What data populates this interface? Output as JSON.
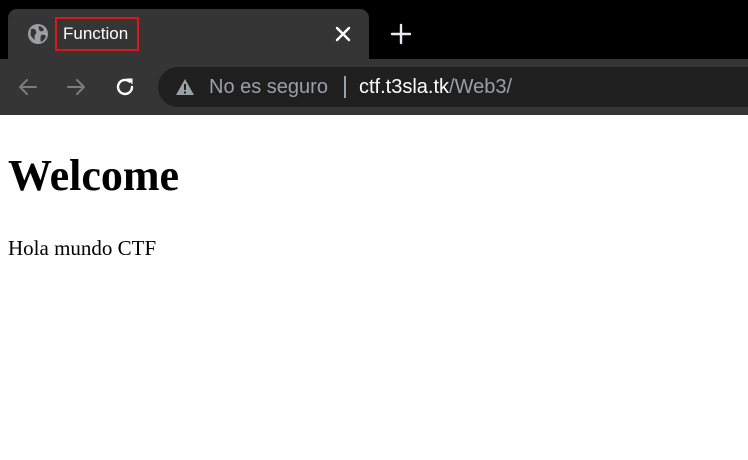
{
  "browser": {
    "tab": {
      "title": "Function",
      "favicon_icon": "globe-icon",
      "close_icon": "close-icon",
      "highlight_color": "#e0151c"
    },
    "new_tab_icon": "plus-icon",
    "toolbar": {
      "back_icon": "arrow-left-icon",
      "forward_icon": "arrow-right-icon",
      "reload_icon": "reload-icon"
    },
    "address_bar": {
      "security_icon": "warning-triangle-icon",
      "security_label": "No es seguro",
      "url_host": "ctf.t3sla.tk",
      "url_path": "/Web3/"
    }
  },
  "page": {
    "heading": "Welcome",
    "paragraph": "Hola mundo CTF"
  }
}
